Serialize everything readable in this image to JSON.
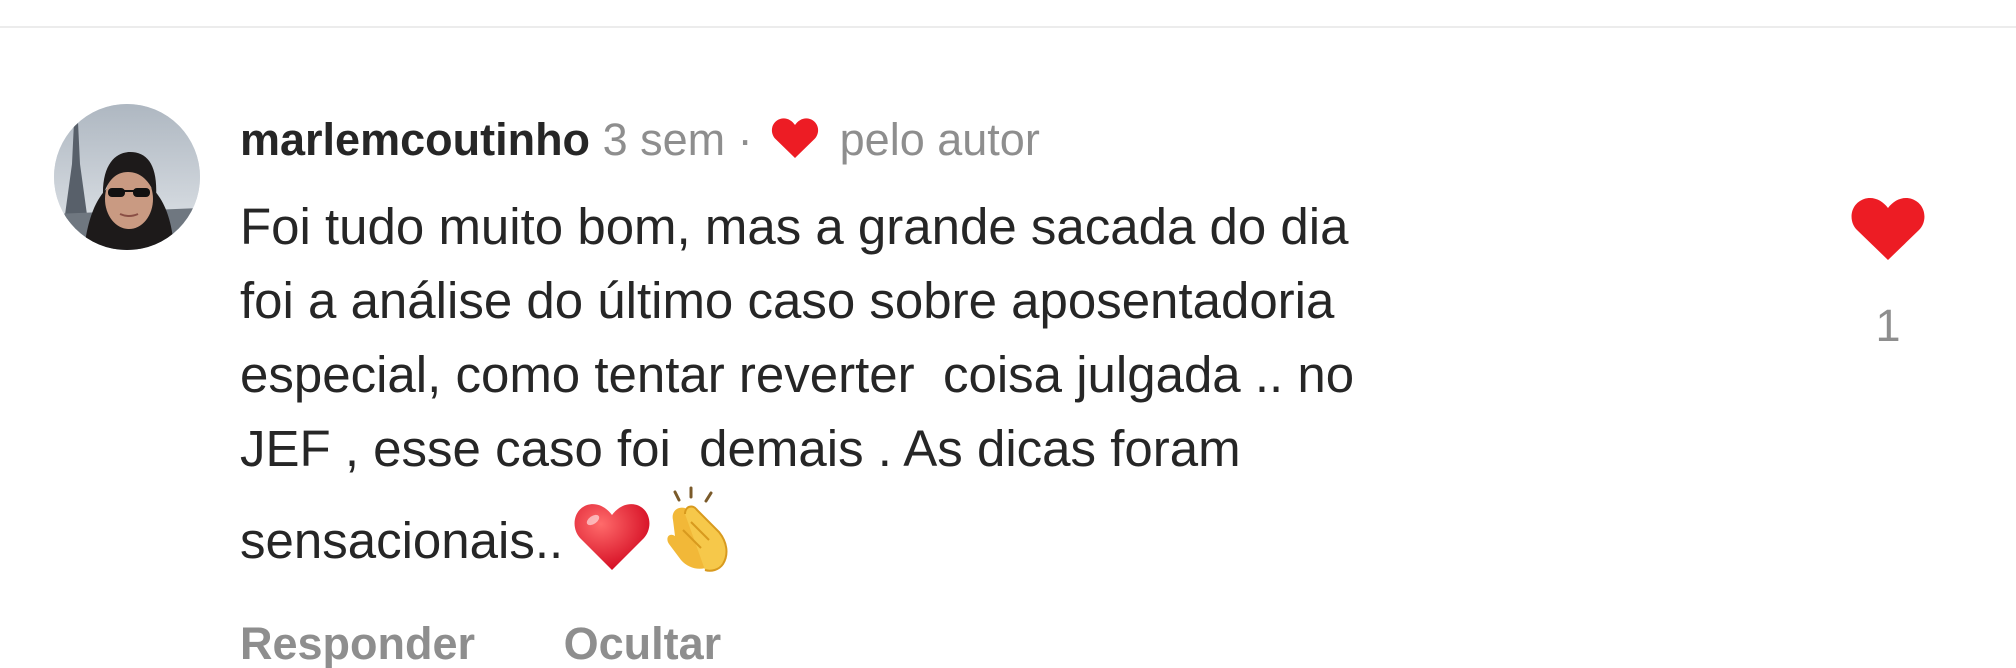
{
  "comment": {
    "username": "marlemcoutinho",
    "time": "3 sem",
    "separator": "·",
    "liked_by_author_label": "pelo autor",
    "body_lines": [
      "Foi tudo muito bom, mas a grande sacada do dia",
      "foi a análise do último caso sobre aposentadoria",
      "especial, como tentar reverter  coisa julgada .. no",
      "JEF , esse caso foi  demais . As dicas foram",
      "sensacionais.."
    ],
    "emojis": [
      "red-heart-emoji",
      "clapping-hands-emoji"
    ],
    "like_count": "1"
  },
  "actions": {
    "reply_label": "Responder",
    "hide_label": "Ocultar"
  },
  "icons": {
    "like": "heart-icon",
    "author_like": "heart-icon"
  },
  "colors": {
    "like_red": "#ed1c24",
    "text": "#262626",
    "secondary": "#8e8e8e"
  }
}
